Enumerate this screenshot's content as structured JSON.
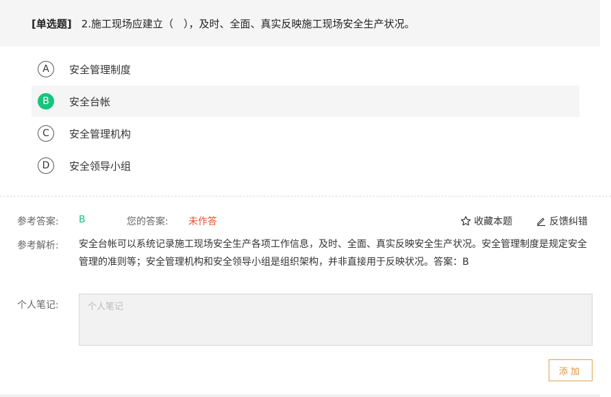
{
  "question": {
    "type_label": "[单选题]",
    "text": "2.施工现场应建立（　），及时、全面、真实反映施工现场安全生产状况。"
  },
  "options": [
    {
      "letter": "A",
      "text": "安全管理制度"
    },
    {
      "letter": "B",
      "text": "安全台帐"
    },
    {
      "letter": "C",
      "text": "安全管理机构"
    },
    {
      "letter": "D",
      "text": "安全领导小组"
    }
  ],
  "selected_option": "B",
  "answer": {
    "ref_label": "参考答案:",
    "ref_value": "B",
    "your_label": "您的答案:",
    "your_value": "未作答"
  },
  "actions": {
    "favorite_label": "收藏本题",
    "feedback_label": "反馈纠错"
  },
  "analysis": {
    "label": "参考解析:",
    "text": "安全台帐可以系统记录施工现场安全生产各项工作信息，及时、全面、真实反映安全生产状况。安全管理制度是规定安全管理的准则等；安全管理机构和安全领导小组是组织架构，并非直接用于反映状况。答案：B"
  },
  "notes": {
    "label": "个人笔记:",
    "placeholder": "个人笔记",
    "value": "",
    "add_label": "添加"
  },
  "colors": {
    "accent_green": "#19c37d",
    "unanswered_red": "#e5532b",
    "add_button_orange": "#e0933a"
  }
}
